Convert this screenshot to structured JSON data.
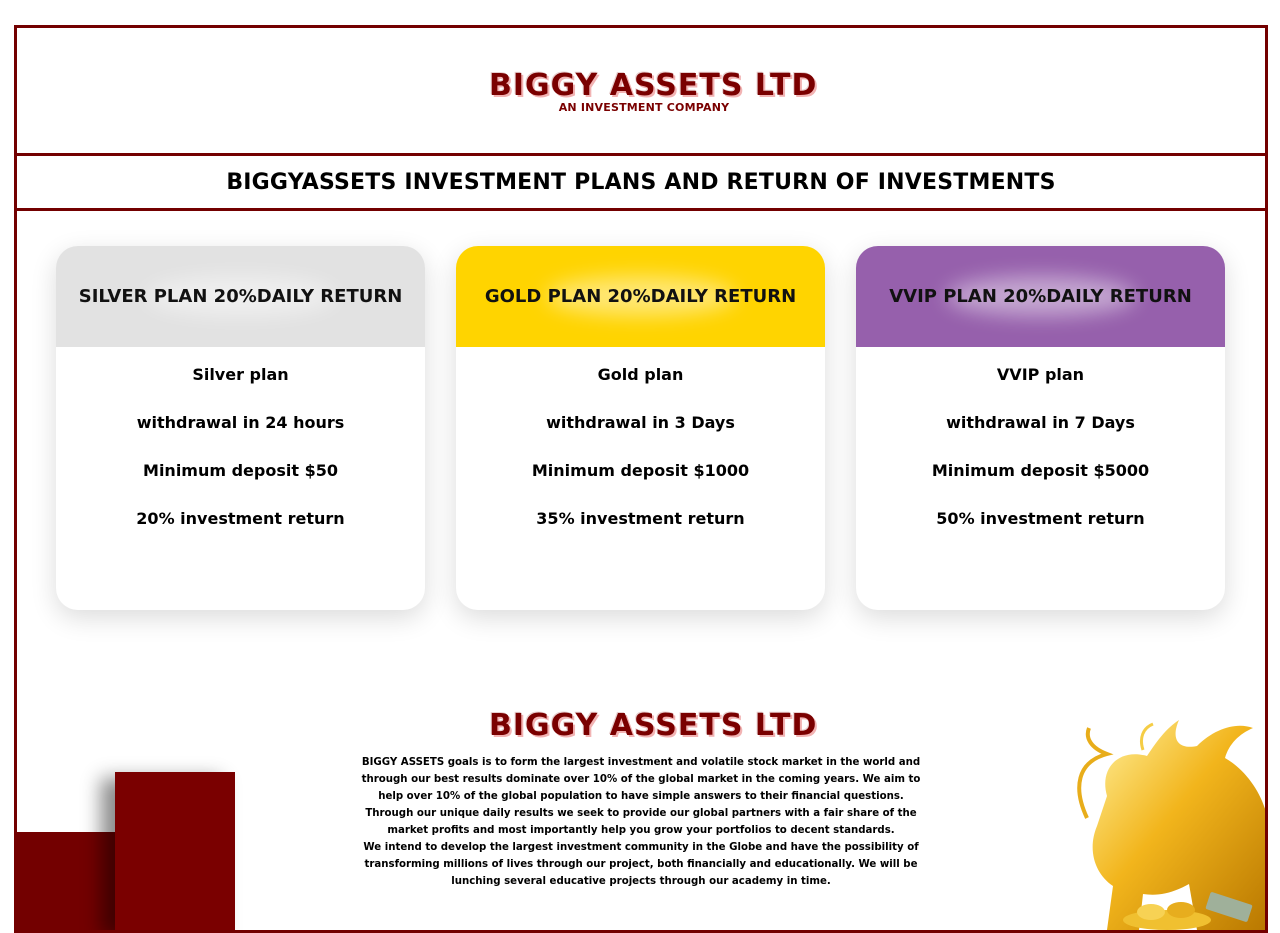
{
  "brand": {
    "name": "BIGGY ASSETS LTD",
    "tagline": "AN INVESTMENT COMPANY"
  },
  "page_title": "BIGGYASSETS INVESTMENT PLANS AND RETURN OF INVESTMENTS",
  "plans": [
    {
      "heading": "SILVER PLAN 20%DAILY RETURN",
      "name": "Silver plan",
      "withdrawal": "withdrawal in 24 hours",
      "deposit": "Minimum deposit $50",
      "return": "20% investment return",
      "color": "#e2e2e2"
    },
    {
      "heading": "GOLD PLAN 20%DAILY RETURN",
      "name": "Gold plan",
      "withdrawal": "withdrawal in 3 Days",
      "deposit": "Minimum deposit $1000",
      "return": "35% investment return",
      "color": "#ffd400"
    },
    {
      "heading": "VVIP PLAN 20%DAILY RETURN",
      "name": "VVIP plan",
      "withdrawal": "withdrawal in 7 Days",
      "deposit": "Minimum deposit $5000",
      "return": "50% investment return",
      "color": "#9660ac"
    }
  ],
  "about": {
    "paragraph1": "BIGGY ASSETS goals is to form the largest investment and volatile stock market in the world and through our best results dominate over 10% of the global market in the coming years. We aim to help over 10% of the global population to have simple answers to their financial questions. Through our unique daily results we seek to provide our global partners with a fair share of the market profits and most importantly help you grow your portfolios to decent standards.",
    "paragraph2": "We intend to develop the largest investment community in the Globe and have the possibility of transforming millions of lives through our project, both financially and educationally. We will be lunching several educative projects through our academy in time."
  },
  "colors": {
    "border": "#730000",
    "brand": "#7a0000"
  },
  "icons": {
    "mascot": "golden-bull-icon"
  }
}
